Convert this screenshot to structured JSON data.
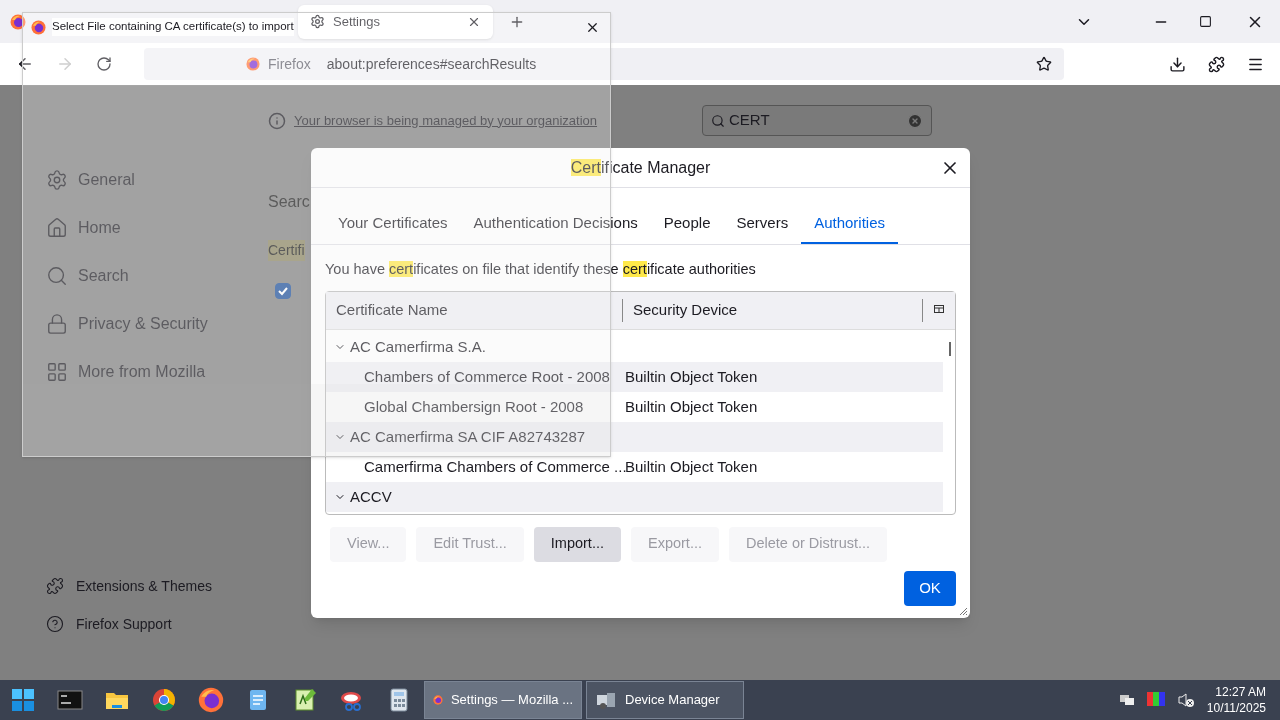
{
  "browser": {
    "tabs": [
      {
        "label": "Settings",
        "selected": true
      }
    ],
    "address": {
      "site": "Firefox",
      "url": "about:preferences#searchResults"
    }
  },
  "page": {
    "sidebar": [
      {
        "label": "General"
      },
      {
        "label": "Home"
      },
      {
        "label": "Search"
      },
      {
        "label": "Privacy & Security"
      },
      {
        "label": "More from Mozilla"
      }
    ],
    "sidebar_footer": [
      {
        "label": "Extensions & Themes"
      },
      {
        "label": "Firefox Support"
      }
    ],
    "notice": "Your browser is being managed by your organization",
    "heading": "Searc",
    "result_title": "Certifi",
    "search": {
      "value": "CERT"
    },
    "checkbox": {
      "checked": true
    }
  },
  "certificate_manager": {
    "title": [
      {
        "text": "Cert",
        "highlight": true
      },
      {
        "text": "ificate Manager",
        "highlight": false
      }
    ],
    "tabs": [
      {
        "label": "Your Certificates",
        "selected": false
      },
      {
        "label": "Authentication Decisions",
        "selected": false
      },
      {
        "label": "People",
        "selected": false
      },
      {
        "label": "Servers",
        "selected": false
      },
      {
        "label": "Authorities",
        "selected": true
      }
    ],
    "description": [
      {
        "text": "You have ",
        "highlight": false
      },
      {
        "text": "cert",
        "highlight": true
      },
      {
        "text": "ificates on file that identify these ",
        "highlight": false
      },
      {
        "text": "cert",
        "highlight": true
      },
      {
        "text": "ificate authorities",
        "highlight": false
      }
    ],
    "columns": [
      "Certificate Name",
      "Security Device"
    ],
    "rows": [
      {
        "kind": "group",
        "name": "AC Camerfirma S.A.",
        "expanded": true
      },
      {
        "kind": "cert",
        "name": "Chambers of Commerce Root - 2008",
        "device": "Builtin Object Token"
      },
      {
        "kind": "cert",
        "name": "Global Chambersign Root - 2008",
        "device": "Builtin Object Token"
      },
      {
        "kind": "group",
        "name": "AC Camerfirma SA CIF A82743287",
        "expanded": true
      },
      {
        "kind": "cert",
        "name": "Camerfirma Chambers of Commerce ...",
        "device": "Builtin Object Token"
      },
      {
        "kind": "group",
        "name": "ACCV",
        "expanded": true
      }
    ],
    "buttons": [
      {
        "label": "View...",
        "disabled": true
      },
      {
        "label": "Edit Trust...",
        "disabled": true
      },
      {
        "label": "Import...",
        "disabled": false
      },
      {
        "label": "Export...",
        "disabled": true
      },
      {
        "label": "Delete or Distrust...",
        "disabled": true
      }
    ],
    "ok": "OK"
  },
  "file_dialog": {
    "title": "Select File containing CA certificate(s) to import"
  },
  "taskbar": {
    "tasks": [
      {
        "label": "Settings — Mozilla ...",
        "selected": true
      },
      {
        "label": "Device Manager",
        "selected": false
      }
    ],
    "time": "12:27 AM",
    "date": "10/11/2025"
  }
}
